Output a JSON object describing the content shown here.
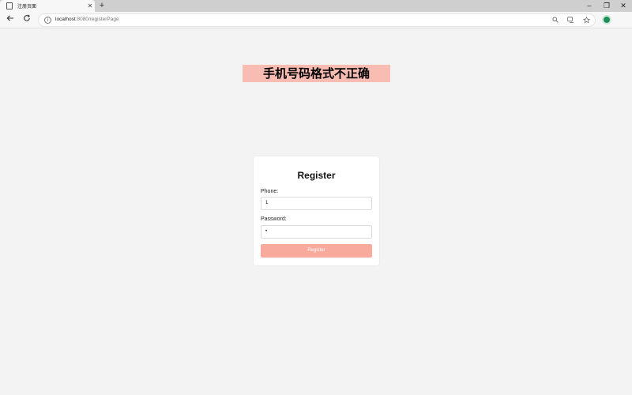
{
  "browser": {
    "tab_title": "注册页面",
    "tab_close": "✕",
    "new_tab": "+",
    "window_controls": {
      "minimize": "–",
      "restore": "❐",
      "close": "✕"
    },
    "url_host": "localhost",
    "url_path": ":8080/registerPage",
    "info_icon": "i"
  },
  "page": {
    "error_message": "手机号码格式不正确"
  },
  "register_form": {
    "title": "Register",
    "phone_label": "Phone:",
    "phone_value": "1",
    "password_label": "Password:",
    "password_value": "•",
    "submit_label": "Register"
  }
}
